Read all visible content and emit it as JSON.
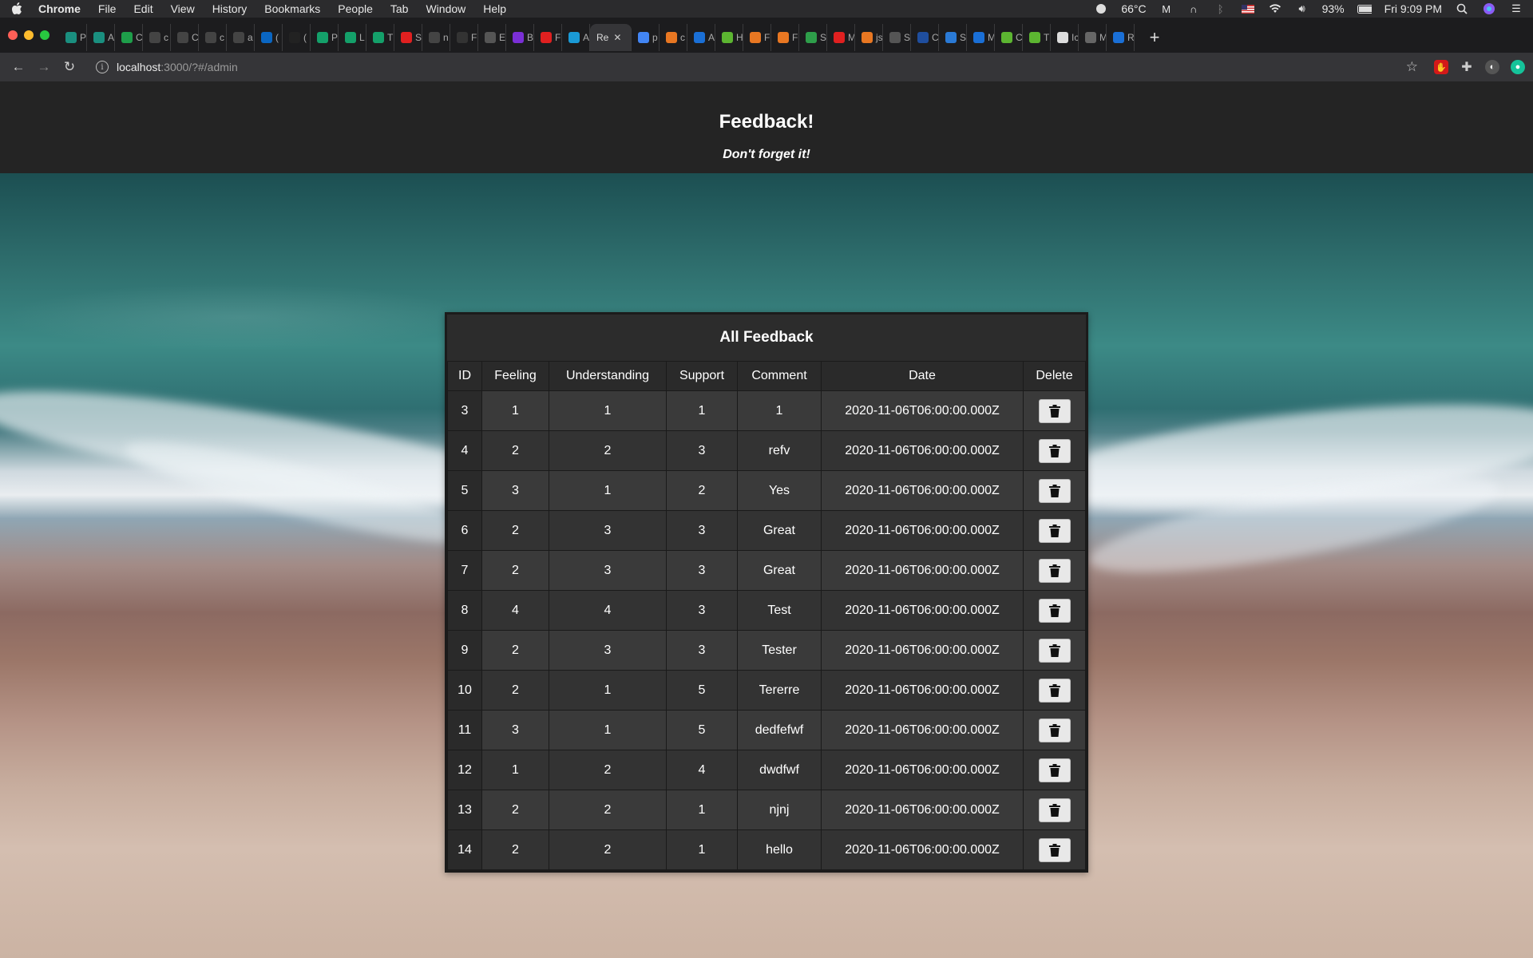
{
  "menubar": {
    "app": "Chrome",
    "items": [
      "File",
      "Edit",
      "View",
      "History",
      "Bookmarks",
      "People",
      "Tab",
      "Window",
      "Help"
    ],
    "temperature": "66°C",
    "battery": "93%",
    "clock": "Fri 9:09 PM"
  },
  "tabs": [
    {
      "letter": "P",
      "color": "#1a8f7f"
    },
    {
      "letter": "A",
      "color": "#1a8f7f"
    },
    {
      "letter": "C",
      "color": "#1e9e4a"
    },
    {
      "letter": "c",
      "color": "#444444"
    },
    {
      "letter": "C",
      "color": "#444444"
    },
    {
      "letter": "c",
      "color": "#444444"
    },
    {
      "letter": "a",
      "color": "#444444"
    },
    {
      "letter": "(",
      "color": "#0a66c2"
    },
    {
      "letter": "(",
      "color": "#222222"
    },
    {
      "letter": "P",
      "color": "#14a06a"
    },
    {
      "letter": "L",
      "color": "#14a06a"
    },
    {
      "letter": "T",
      "color": "#14a06a"
    },
    {
      "letter": "S",
      "color": "#e02020"
    },
    {
      "letter": "n",
      "color": "#444444"
    },
    {
      "letter": "F",
      "color": "#333333"
    },
    {
      "letter": "E",
      "color": "#555555"
    },
    {
      "letter": "B",
      "color": "#7a2fd6"
    },
    {
      "letter": "F",
      "color": "#e02020"
    },
    {
      "letter": "A",
      "color": "#1a9ad6"
    },
    {
      "letter": "Re",
      "color": "#353538"
    },
    {
      "letter": "p",
      "color": "#4285f4"
    },
    {
      "letter": "c",
      "color": "#e87722"
    },
    {
      "letter": "A",
      "color": "#1a6fd6"
    },
    {
      "letter": "H",
      "color": "#5cb531"
    },
    {
      "letter": "F",
      "color": "#e87722"
    },
    {
      "letter": "F",
      "color": "#e87722"
    },
    {
      "letter": "S",
      "color": "#2e9e4a"
    },
    {
      "letter": "M",
      "color": "#e02020"
    },
    {
      "letter": "js",
      "color": "#e87722"
    },
    {
      "letter": "S",
      "color": "#555555"
    },
    {
      "letter": "C",
      "color": "#1f4e9e"
    },
    {
      "letter": "S",
      "color": "#2a7ad6"
    },
    {
      "letter": "M",
      "color": "#1a6fd6"
    },
    {
      "letter": "C",
      "color": "#5cb531"
    },
    {
      "letter": "T",
      "color": "#5cb531"
    },
    {
      "letter": "Ic",
      "color": "#dddddd"
    },
    {
      "letter": "M",
      "color": "#666666"
    },
    {
      "letter": "R",
      "color": "#1a6fd6"
    }
  ],
  "address": {
    "host": "localhost",
    "path": ":3000/?#/admin"
  },
  "header": {
    "title": "Feedback!",
    "subtitle": "Don't forget it!"
  },
  "panel": {
    "title": "All Feedback",
    "columns": [
      "ID",
      "Feeling",
      "Understanding",
      "Support",
      "Comment",
      "Date",
      "Delete"
    ],
    "rows": [
      {
        "id": "3",
        "feeling": "1",
        "understanding": "1",
        "support": "1",
        "comment": "1",
        "date": "2020-11-06T06:00:00.000Z"
      },
      {
        "id": "4",
        "feeling": "2",
        "understanding": "2",
        "support": "3",
        "comment": "refv",
        "date": "2020-11-06T06:00:00.000Z"
      },
      {
        "id": "5",
        "feeling": "3",
        "understanding": "1",
        "support": "2",
        "comment": "Yes",
        "date": "2020-11-06T06:00:00.000Z"
      },
      {
        "id": "6",
        "feeling": "2",
        "understanding": "3",
        "support": "3",
        "comment": "Great",
        "date": "2020-11-06T06:00:00.000Z"
      },
      {
        "id": "7",
        "feeling": "2",
        "understanding": "3",
        "support": "3",
        "comment": "Great",
        "date": "2020-11-06T06:00:00.000Z"
      },
      {
        "id": "8",
        "feeling": "4",
        "understanding": "4",
        "support": "3",
        "comment": "Test",
        "date": "2020-11-06T06:00:00.000Z"
      },
      {
        "id": "9",
        "feeling": "2",
        "understanding": "3",
        "support": "3",
        "comment": "Tester",
        "date": "2020-11-06T06:00:00.000Z"
      },
      {
        "id": "10",
        "feeling": "2",
        "understanding": "1",
        "support": "5",
        "comment": "Tererre",
        "date": "2020-11-06T06:00:00.000Z"
      },
      {
        "id": "11",
        "feeling": "3",
        "understanding": "1",
        "support": "5",
        "comment": "dedfefwf",
        "date": "2020-11-06T06:00:00.000Z"
      },
      {
        "id": "12",
        "feeling": "1",
        "understanding": "2",
        "support": "4",
        "comment": "dwdfwf",
        "date": "2020-11-06T06:00:00.000Z"
      },
      {
        "id": "13",
        "feeling": "2",
        "understanding": "2",
        "support": "1",
        "comment": "njnj",
        "date": "2020-11-06T06:00:00.000Z"
      },
      {
        "id": "14",
        "feeling": "2",
        "understanding": "2",
        "support": "1",
        "comment": "hello",
        "date": "2020-11-06T06:00:00.000Z"
      }
    ]
  }
}
